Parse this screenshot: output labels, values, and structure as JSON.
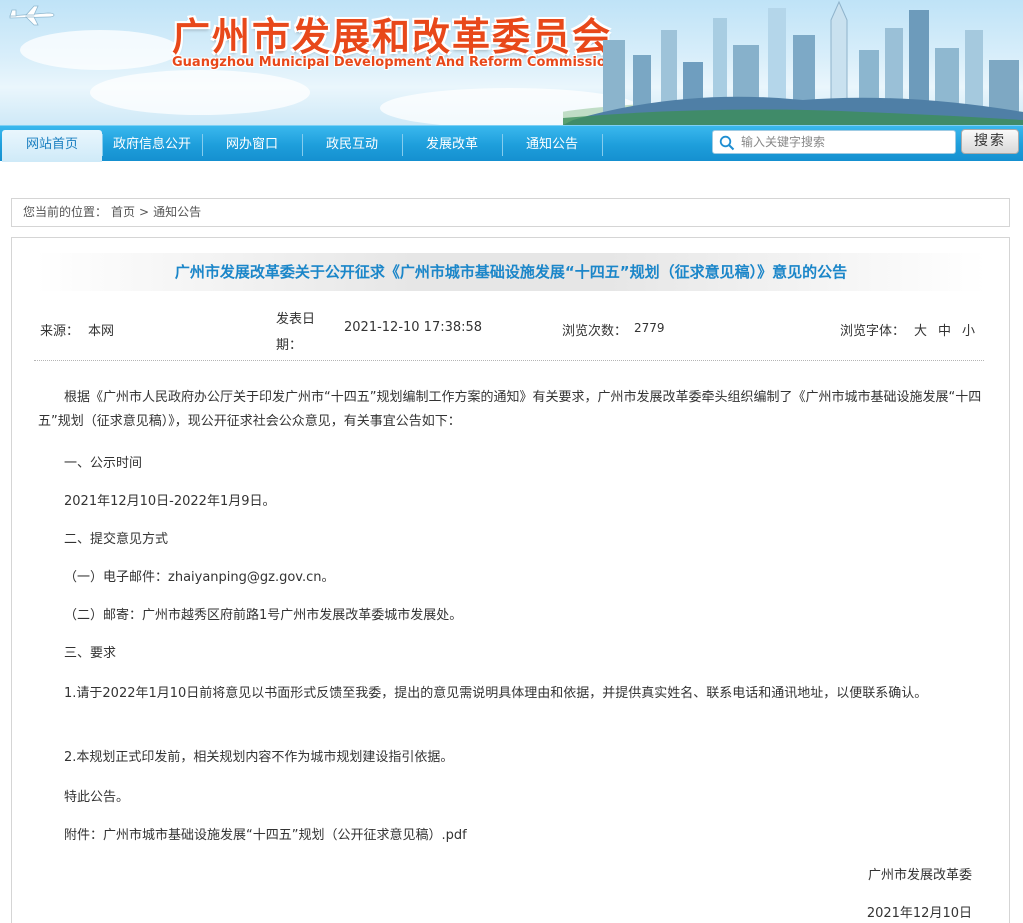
{
  "header": {
    "title_cn": "广州市发展和改革委员会",
    "title_en": "Guangzhou Municipal Development And Reform Commission"
  },
  "nav": {
    "items": [
      {
        "label": "网站首页",
        "active": true
      },
      {
        "label": "政府信息公开"
      },
      {
        "label": "网办窗口"
      },
      {
        "label": "政民互动"
      },
      {
        "label": "发展改革"
      },
      {
        "label": "通知公告"
      }
    ],
    "search_placeholder": "输入关键字搜索",
    "search_button": "搜索"
  },
  "breadcrumb": {
    "prefix": "您当前的位置：",
    "home": "首页",
    "separator": ">",
    "current": "通知公告"
  },
  "article": {
    "title": "广州市发展改革委关于公开征求《广州市城市基础设施发展“十四五”规划（征求意见稿）》意见的公告",
    "meta": {
      "source_label": "来源：",
      "source_value": "本网",
      "date_label_1": "发表日",
      "date_label_2": "期：",
      "date_value": "2021-12-10 17:38:58",
      "views_label": "浏览次数：",
      "views_value": "2779",
      "font_label": "浏览字体：",
      "font_large": "大",
      "font_medium": "中",
      "font_small": "小"
    },
    "paragraphs": {
      "intro": "根据《广州市人民政府办公厅关于印发广州市“十四五”规划编制工作方案的通知》有关要求，广州市发展改革委牵头组织编制了《广州市城市基础设施发展“十四五”规划（征求意见稿）》，现公开征求社会公众意见，有关事宜公告如下：",
      "s1_title": "一、公示时间",
      "s1_body": "2021年12月10日-2022年1月9日。",
      "s2_title": "二、提交意见方式",
      "s2_email": "（一）电子邮件：zhaiyanping@gz.gov.cn。",
      "s2_mail": "（二）邮寄：广州市越秀区府前路1号广州市发展改革委城市发展处。",
      "s3_title": "三、要求",
      "s3_r1": "1.请于2022年1月10日前将意见以书面形式反馈至我委，提出的意见需说明具体理由和依据，并提供真实姓名、联系电话和通讯地址，以便联系确认。",
      "s3_r2": "2.本规划正式印发前，相关规划内容不作为城市规划建设指引依据。",
      "closing": "特此公告。",
      "attachment": "附件：广州市城市基础设施发展“十四五”规划（公开征求意见稿）.pdf",
      "signature": "广州市发展改革委",
      "sign_date": "2021年12月10日"
    }
  },
  "colors": {
    "nav_blue": "#1e9edb",
    "title_blue": "#1b86c9",
    "header_red": "#e8481a"
  }
}
